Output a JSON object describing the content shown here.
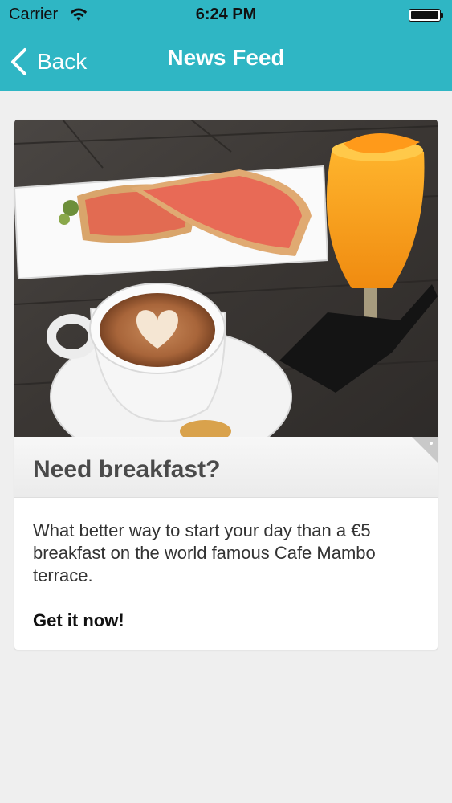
{
  "status_bar": {
    "carrier": "Carrier",
    "time": "6:24 PM",
    "wifi_icon": "wifi-icon",
    "battery_icon": "battery-icon"
  },
  "nav": {
    "back_label": "Back",
    "back_icon": "chevron-left-icon",
    "title": "News Feed",
    "bar_color": "#2fb6c4"
  },
  "feed": {
    "card": {
      "image": "breakfast-photo",
      "title": "Need breakfast?",
      "body": "What better way to start your day than a €5 breakfast on the world famous Cafe Mambo terrace.",
      "cta": "Get it now!"
    }
  }
}
